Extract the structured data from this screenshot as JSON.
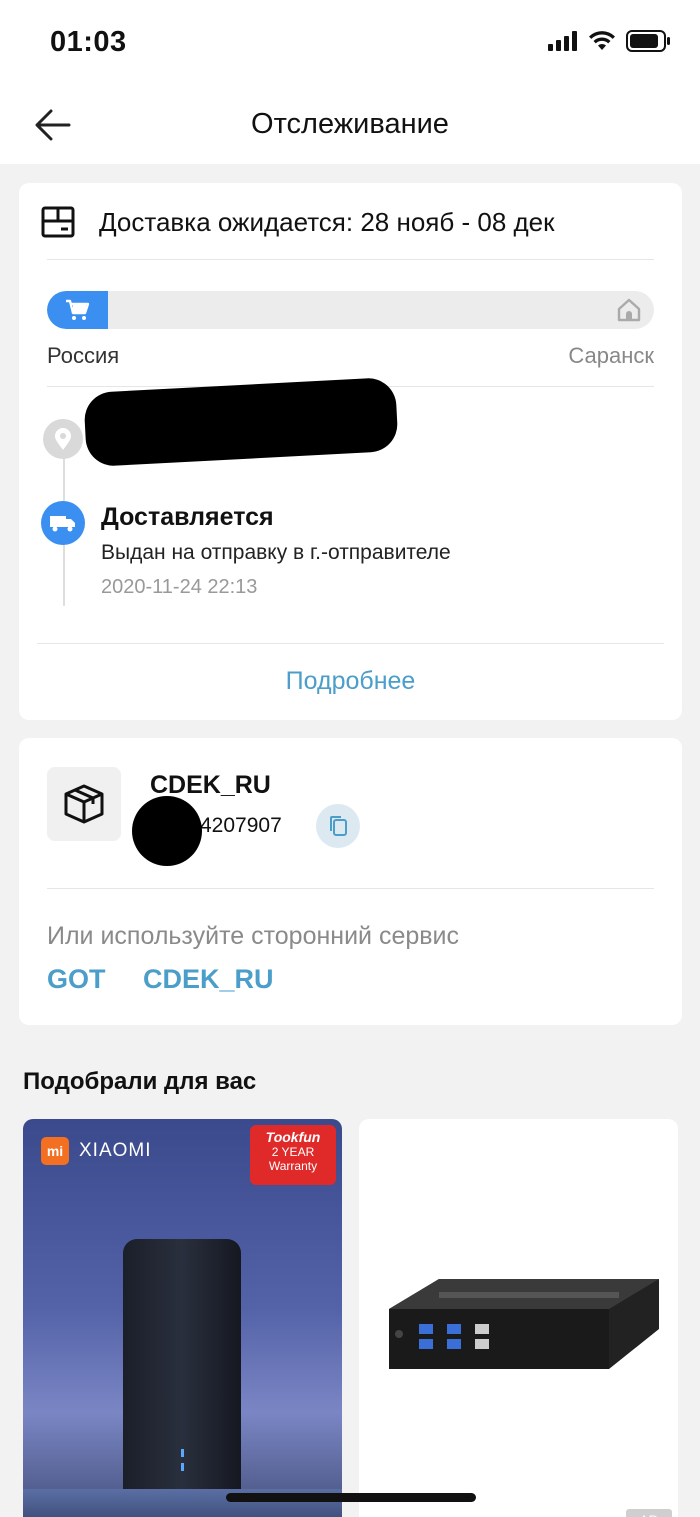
{
  "status_bar": {
    "time": "01:03",
    "icons": [
      "signal-icon",
      "wifi-icon",
      "battery-icon"
    ]
  },
  "navbar": {
    "title": "Отслеживание",
    "back_icon": "arrow-left-icon"
  },
  "delivery": {
    "eta": "Доставка ожидается: 28 нояб - 08 дек",
    "progress_fraction": 0.1,
    "route_from": "Россия",
    "route_to": "Саранск",
    "timeline": {
      "address_redacted": true,
      "status_title": "Доставляется",
      "status_desc": "Выдан на отправку в г.-отправителе",
      "status_time": "2020-11-24 22:13"
    },
    "more_label": "Подробнее"
  },
  "shipment": {
    "carrier": "CDEK_RU",
    "tracking_visible": "4207907",
    "alt_label": "Или используйте сторонний сервис",
    "alt_services": [
      "GOT",
      "CDEK_RU"
    ]
  },
  "recommendations": {
    "title": "Подобрали для вас",
    "products": [
      {
        "brand": "XIAOMI",
        "brand_logo": "mi",
        "badge_brand": "Tookfun",
        "badge_text": "2 YEAR Warranty"
      },
      {
        "ad_label": "AD"
      }
    ]
  },
  "colors": {
    "accent_blue": "#3a8ff0",
    "link_blue": "#4a9ec9",
    "background": "#f2f2f2"
  }
}
